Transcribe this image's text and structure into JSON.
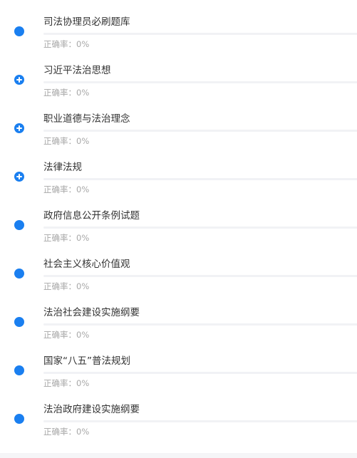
{
  "accuracy_label": "正确率：",
  "colors": {
    "accent": "#1a7ff0",
    "title_text": "#333333",
    "meta_text": "#a7a7a7",
    "track": "#f1f2f5"
  },
  "items": [
    {
      "title": "司法协理员必刷题库",
      "accuracy": "0%",
      "progress": 0,
      "icon": "dot-icon"
    },
    {
      "title": "习近平法治思想",
      "accuracy": "0%",
      "progress": 0,
      "icon": "expand-plus-icon"
    },
    {
      "title": "职业道德与法治理念",
      "accuracy": "0%",
      "progress": 0,
      "icon": "expand-plus-icon"
    },
    {
      "title": "法律法规",
      "accuracy": "0%",
      "progress": 0,
      "icon": "expand-plus-icon"
    },
    {
      "title": "政府信息公开条例试题",
      "accuracy": "0%",
      "progress": 0,
      "icon": "dot-icon"
    },
    {
      "title": "社会主义核心价值观",
      "accuracy": "0%",
      "progress": 0,
      "icon": "dot-icon"
    },
    {
      "title": "法治社会建设实施纲要",
      "accuracy": "0%",
      "progress": 0,
      "icon": "dot-icon"
    },
    {
      "title": "国家“八五”普法规划",
      "accuracy": "0%",
      "progress": 0,
      "icon": "dot-icon"
    },
    {
      "title": "法治政府建设实施纲要",
      "accuracy": "0%",
      "progress": 0,
      "icon": "dot-icon"
    }
  ]
}
